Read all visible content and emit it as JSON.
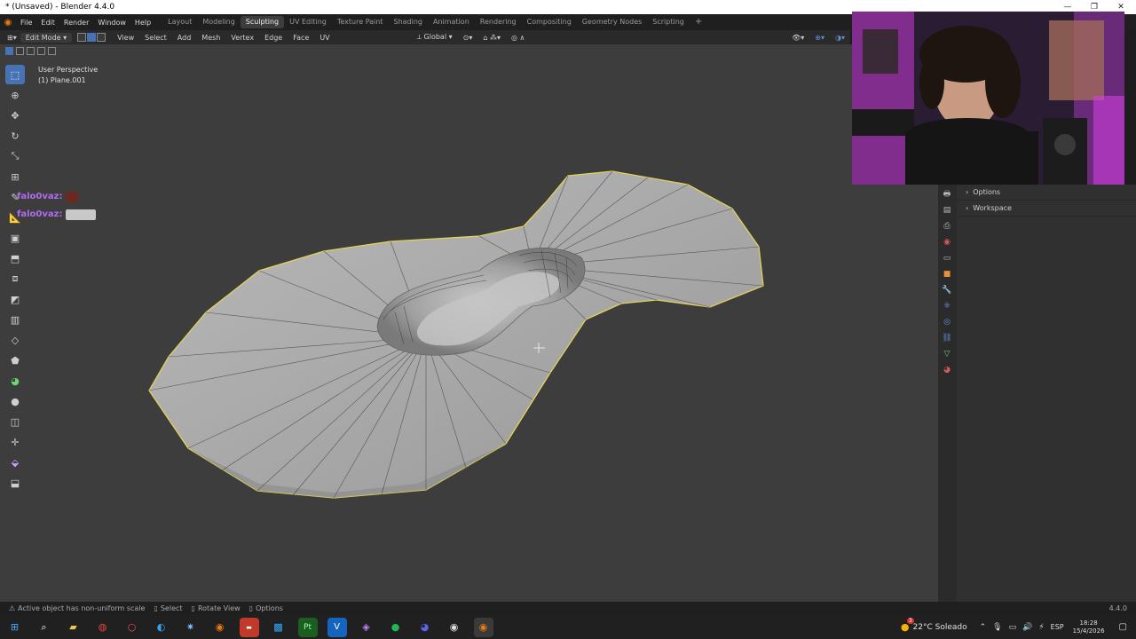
{
  "window": {
    "title": "* (Unsaved) - Blender 4.4.0"
  },
  "menus": [
    "File",
    "Edit",
    "Render",
    "Window",
    "Help"
  ],
  "workspaces": [
    {
      "label": "Layout",
      "active": false
    },
    {
      "label": "Modeling",
      "active": false
    },
    {
      "label": "Sculpting",
      "active": true
    },
    {
      "label": "UV Editing",
      "active": false
    },
    {
      "label": "Texture Paint",
      "active": false
    },
    {
      "label": "Shading",
      "active": false
    },
    {
      "label": "Animation",
      "active": false
    },
    {
      "label": "Rendering",
      "active": false
    },
    {
      "label": "Compositing",
      "active": false
    },
    {
      "label": "Geometry Nodes",
      "active": false
    },
    {
      "label": "Scripting",
      "active": false
    }
  ],
  "header": {
    "mode": "Edit Mode",
    "menus": [
      "View",
      "Select",
      "Add",
      "Mesh",
      "Vertex",
      "Edge",
      "Face",
      "UV"
    ],
    "transform_orientation": "Global"
  },
  "viewport": {
    "perspective_label": "User Perspective",
    "object_label": "(1) Plane.001"
  },
  "chat": [
    {
      "user": "falo0vaz:"
    },
    {
      "user": "falo0vaz:"
    }
  ],
  "properties": {
    "items": [
      "Options",
      "Workspace"
    ]
  },
  "status": {
    "warning": "Active object has non-uniform scale",
    "hints": [
      "Select",
      "Rotate View",
      "Options"
    ],
    "version": "4.4.0"
  },
  "taskbar": {
    "weather": "22°C  Soleado",
    "weather_badge": "3",
    "language": "ESP",
    "time": "18:28",
    "date": "15/4/2026"
  },
  "colors": {
    "accent": "#4772b3",
    "selection_outline": "#e2d25a",
    "chat_name": "#b06cf0"
  }
}
